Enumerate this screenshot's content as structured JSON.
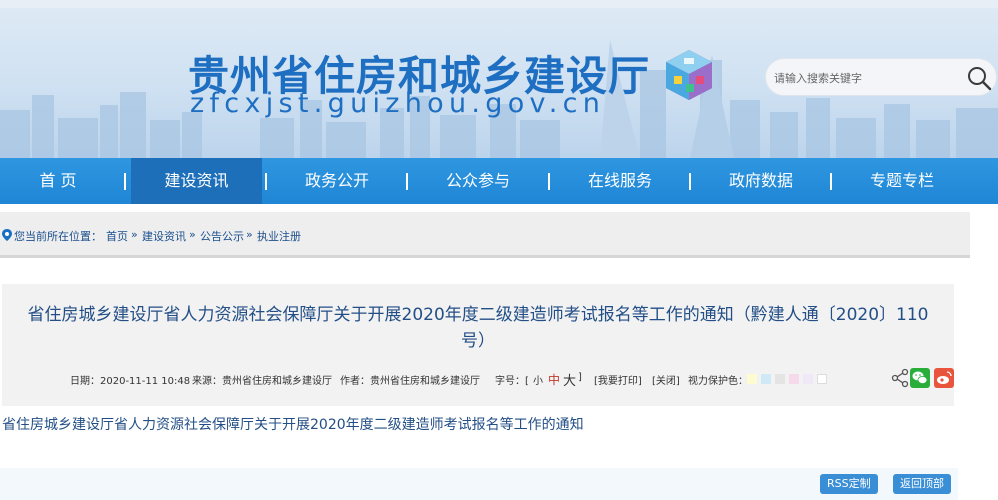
{
  "header": {
    "site_title": "贵州省住房和城乡建设厅",
    "site_domain": "zfcxjst.guizhou.gov.cn",
    "search": {
      "placeholder": "请输入搜索关键字"
    }
  },
  "nav": {
    "items": [
      {
        "label": "首  页"
      },
      {
        "label": "建设资讯"
      },
      {
        "label": "政务公开"
      },
      {
        "label": "公众参与"
      },
      {
        "label": "在线服务"
      },
      {
        "label": "政府数据"
      },
      {
        "label": "专题专栏"
      }
    ],
    "active_index": 1
  },
  "breadcrumb": {
    "prefix": "您当前所在位置：",
    "items": [
      "首页",
      "建设资讯",
      "公告公示",
      "执业注册"
    ],
    "separator": "»"
  },
  "article": {
    "title": "省住房城乡建设厅省人力资源社会保障厅关于开展2020年度二级建造师考试报名等工作的通知（黔建人通〔2020〕110号）",
    "date": "日期：2020-11-11 10:48",
    "source": "来源：贵州省住房和城乡建设厅",
    "author": "作者：贵州省住房和城乡建设厅",
    "font_size_label": "字号：[",
    "font_small": "小",
    "font_medium": "中",
    "font_large": "大",
    "font_size_close": "]",
    "print": "[我要打印]",
    "close": "[关闭]",
    "eye_protection": "视力保护色：",
    "eye_colors": [
      "#fdfbd0",
      "#cfe9f7",
      "#e4e4e4",
      "#f7d9ec",
      "#f0e8f7",
      "#ffffff"
    ],
    "body": "省住房城乡建设厅省人力资源社会保障厅关于开展2020年度二级建造师考试报名等工作的通知"
  },
  "footer": {
    "rss": "RSS定制",
    "back_to_top": "返回顶部"
  },
  "colors": {
    "brand_blue": "#1e6fc2",
    "nav_blue": "#1f86d6",
    "nav_active": "#1c6fb8",
    "wechat_green": "#2aae3a",
    "weibo_orange": "#e8553c"
  }
}
